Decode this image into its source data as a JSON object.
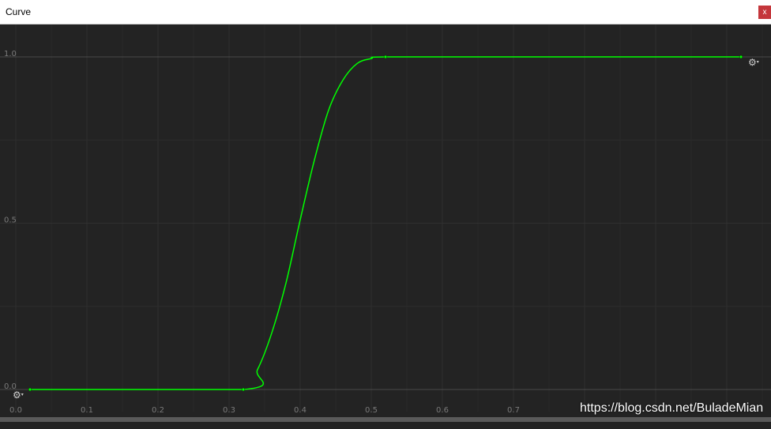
{
  "window": {
    "title": "Curve",
    "close_label": "x"
  },
  "chart_data": {
    "type": "line",
    "title": "",
    "xlabel": "",
    "ylabel": "",
    "xlim": [
      0.0,
      1.0
    ],
    "ylim": [
      0.0,
      1.0
    ],
    "x_ticks": [
      "0.0",
      "0.1",
      "0.2",
      "0.3",
      "0.4",
      "0.5",
      "0.6",
      "0.7"
    ],
    "y_ticks": [
      "0.0",
      "0.5",
      "1.0"
    ],
    "grid": true,
    "series": [
      {
        "color": "#00ff00",
        "keyframes": [
          {
            "x": 0.02,
            "y": 0.0
          },
          {
            "x": 0.32,
            "y": 0.0
          },
          {
            "x": 0.52,
            "y": 1.0
          },
          {
            "x": 1.02,
            "y": 1.0
          }
        ],
        "points": [
          {
            "x": 0.02,
            "y": 0.0
          },
          {
            "x": 0.32,
            "y": 0.0
          },
          {
            "x": 0.34,
            "y": 0.06
          },
          {
            "x": 0.36,
            "y": 0.17
          },
          {
            "x": 0.38,
            "y": 0.32
          },
          {
            "x": 0.4,
            "y": 0.51
          },
          {
            "x": 0.42,
            "y": 0.69
          },
          {
            "x": 0.44,
            "y": 0.84
          },
          {
            "x": 0.46,
            "y": 0.93
          },
          {
            "x": 0.48,
            "y": 0.98
          },
          {
            "x": 0.5,
            "y": 0.995
          },
          {
            "x": 0.52,
            "y": 1.0
          },
          {
            "x": 0.7,
            "y": 1.0
          },
          {
            "x": 1.02,
            "y": 1.0
          }
        ]
      }
    ]
  },
  "watermark": "https://blog.csdn.net/BuladeMian",
  "icons": {
    "gear_left": "gear-icon",
    "gear_right": "gear-icon"
  }
}
